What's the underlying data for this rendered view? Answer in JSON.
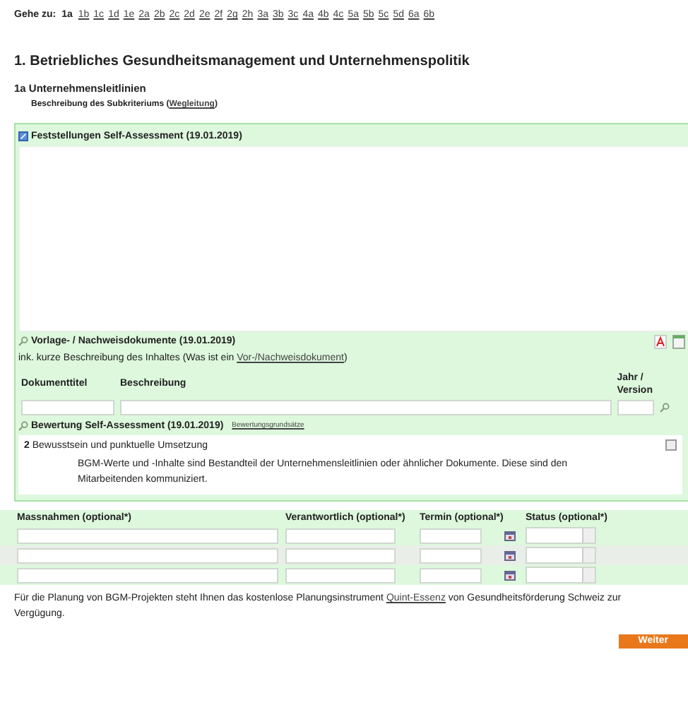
{
  "goto": {
    "label": "Gehe zu:",
    "items": [
      {
        "label": "1a",
        "selected": true
      },
      {
        "label": "1b",
        "selected": false
      },
      {
        "label": "1c",
        "selected": false
      },
      {
        "label": "1d",
        "selected": false
      },
      {
        "label": "1e",
        "selected": false
      },
      {
        "label": "2a",
        "selected": false
      },
      {
        "label": "2b",
        "selected": false
      },
      {
        "label": "2c",
        "selected": false
      },
      {
        "label": "2d",
        "selected": false
      },
      {
        "label": "2e",
        "selected": false
      },
      {
        "label": "2f",
        "selected": false
      },
      {
        "label": "2g",
        "selected": false
      },
      {
        "label": "2h",
        "selected": false
      },
      {
        "label": "3a",
        "selected": false
      },
      {
        "label": "3b",
        "selected": false
      },
      {
        "label": "3c",
        "selected": false
      },
      {
        "label": "4a",
        "selected": false
      },
      {
        "label": "4b",
        "selected": false
      },
      {
        "label": "4c",
        "selected": false
      },
      {
        "label": "5a",
        "selected": false
      },
      {
        "label": "5b",
        "selected": false
      },
      {
        "label": "5c",
        "selected": false
      },
      {
        "label": "5d",
        "selected": false
      },
      {
        "label": "6a",
        "selected": false
      },
      {
        "label": "6b",
        "selected": false
      }
    ]
  },
  "heading": "1. Betriebliches Gesundheitsmanagement und Unternehmenspolitik",
  "subheading": "1a Unternehmensleitlinien",
  "description": {
    "text": "Beschreibung des Subkriteriums (",
    "link": "Wegleitung",
    "after": ")"
  },
  "findings": {
    "title": "Feststellungen Self-Assessment (19.01.2019)"
  },
  "documents": {
    "title": "Vorlage- / Nachweisdokumente (19.01.2019)",
    "note": "ink. kurze Beschreibung des Inhaltes (Was ist ein ",
    "note_link": "Vor-/Nachweisdokument",
    "note_after": ")",
    "columns": [
      "Dokumenttitel",
      "Beschreibung",
      "Jahr / Version"
    ]
  },
  "rating": {
    "title": "Bewertung Self-Assessment (19.01.2019)",
    "link": "Bewertungsgrundsätze",
    "level_number": "2",
    "level_label": "Bewusstsein und punktuelle Umsetzung",
    "text": "BGM-Werte und -Inhalte sind Bestandteil der Unternehmensleitlinien oder ähnlicher Dokumente. Diese sind den Mitarbeitenden kommuniziert."
  },
  "measures": {
    "columns": [
      "Massnahmen (optional*)",
      "Verantwortlich (optional*)",
      "Termin (optional*)",
      "Status (optional*)"
    ]
  },
  "footer": {
    "text": "Für die Planung von BGM-Projekten steht Ihnen das kostenlose Planungsinstrument ",
    "link": "Quint-Essenz",
    "after": " von Gesundheitsförderung Schweiz zur Vergügung."
  },
  "next_button": "Weiter"
}
